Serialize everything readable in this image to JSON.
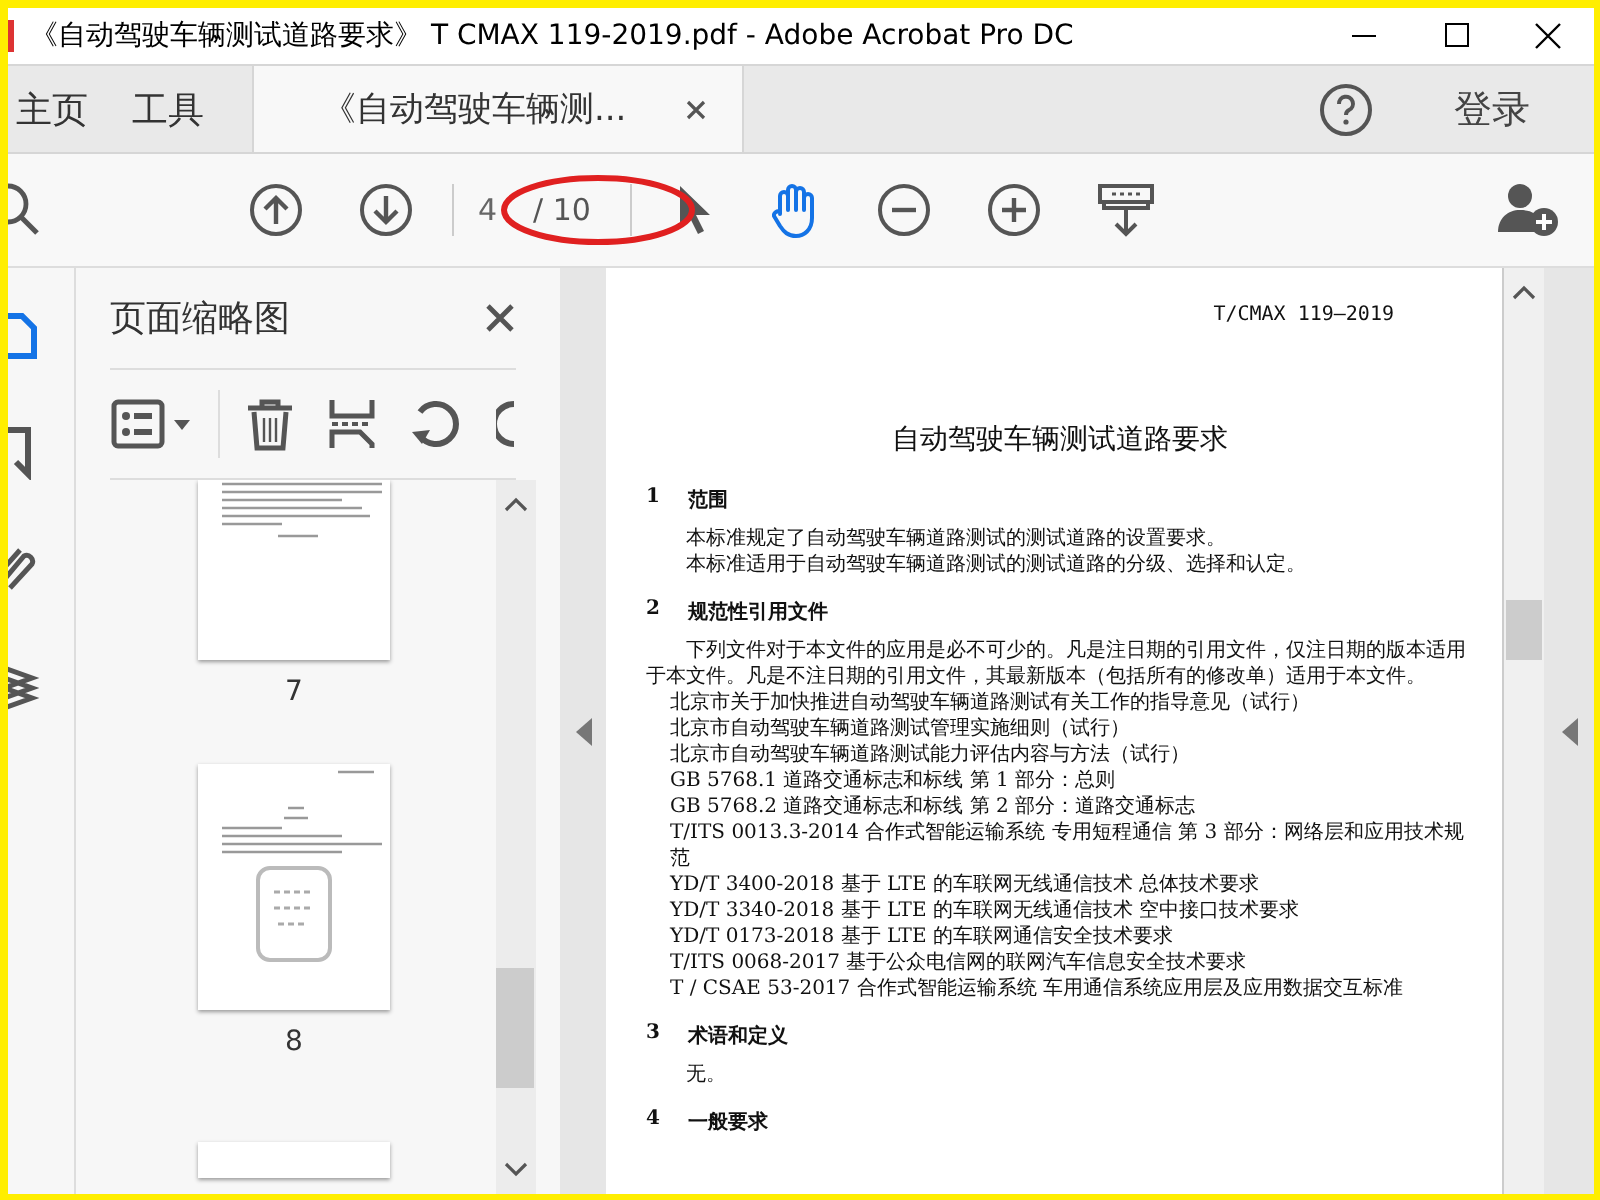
{
  "window": {
    "title": "《自动驾驶车辆测试道路要求》 T CMAX 119-2019.pdf - Adobe Acrobat Pro DC"
  },
  "tabs": [
    {
      "label": "主页",
      "kind": "nav",
      "selected": false
    },
    {
      "label": "工具",
      "kind": "nav",
      "selected": false
    },
    {
      "label": "《自动驾驶车辆测...",
      "kind": "document",
      "selected": true
    }
  ],
  "header_actions": {
    "sign_in": "登录"
  },
  "toolbar": {
    "page_current": "4",
    "page_total": "/ 10",
    "tools": [
      {
        "kind": "select",
        "selected": false
      },
      {
        "kind": "hand",
        "selected": true
      }
    ]
  },
  "left_rail": [
    {
      "kind": "pages",
      "selected": true
    },
    {
      "kind": "bookmarks",
      "selected": false
    },
    {
      "kind": "attachments",
      "selected": false
    },
    {
      "kind": "layers",
      "selected": false
    }
  ],
  "thumbnail_panel": {
    "title": "页面缩略图",
    "pages": [
      {
        "label": "7"
      },
      {
        "label": "8"
      }
    ]
  },
  "document": {
    "header_code": "T/CMAX 119—2019",
    "title": "自动驾驶车辆测试道路要求",
    "sections": [
      {
        "number": "1",
        "heading": "范围",
        "paragraphs": [
          "本标准规定了自动驾驶车辆道路测试的测试道路的设置要求。",
          "本标准适用于自动驾驶车辆道路测试的测试道路的分级、选择和认定。"
        ]
      },
      {
        "number": "2",
        "heading": "规范性引用文件",
        "paragraphs": [
          "下列文件对于本文件的应用是必不可少的。凡是注日期的引用文件，仅注日期的版本适用于本文件。凡是不注日期的引用文件，其最新版本（包括所有的修改单）适用于本文件。"
        ],
        "references": [
          "北京市关于加快推进自动驾驶车辆道路测试有关工作的指导意见（试行）",
          "北京市自动驾驶车辆道路测试管理实施细则（试行）",
          "北京市自动驾驶车辆道路测试能力评估内容与方法（试行）",
          "GB 5768.1 道路交通标志和标线 第 1 部分：总则",
          "GB 5768.2 道路交通标志和标线 第 2 部分：道路交通标志",
          "T/ITS 0013.3-2014 合作式智能运输系统 专用短程通信 第 3 部分：网络层和应用技术规范",
          "YD/T 3400-2018 基于 LTE 的车联网无线通信技术 总体技术要求",
          "YD/T 3340-2018 基于 LTE 的车联网无线通信技术 空中接口技术要求",
          "YD/T 0173-2018 基于 LTE 的车联网通信安全技术要求",
          "T/ITS 0068-2017 基于公众电信网的联网汽车信息安全技术要求",
          "T / CSAE 53-2017 合作式智能运输系统 车用通信系统应用层及应用数据交互标准"
        ]
      },
      {
        "number": "3",
        "heading": "术语和定义",
        "paragraphs": [
          "无。"
        ]
      },
      {
        "number": "4",
        "heading": "一般要求"
      }
    ]
  }
}
